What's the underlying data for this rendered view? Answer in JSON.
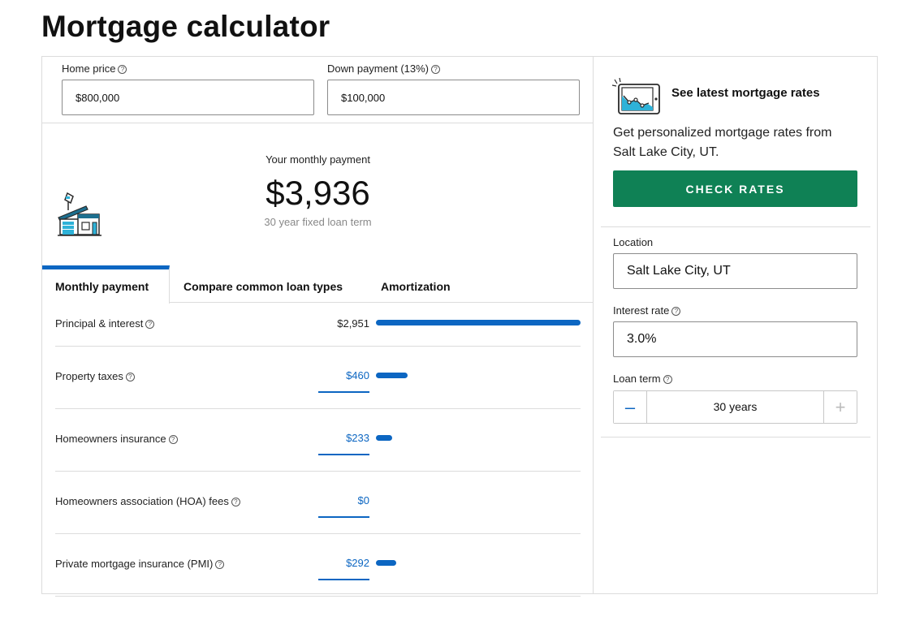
{
  "page_title": "Mortgage calculator",
  "help_glyph": "?",
  "home_price": {
    "label": "Home price",
    "value": "$800,000"
  },
  "down_payment": {
    "label": "Down payment (13%)",
    "value": "$100,000"
  },
  "monthly": {
    "label": "Your monthly payment",
    "amount": "$3,936",
    "term": "30 year fixed loan term",
    "icon": "house-icon"
  },
  "tabs": [
    {
      "label": "Monthly payment",
      "active": true
    },
    {
      "label": "Compare common loan types",
      "active": false
    },
    {
      "label": "Amortization",
      "active": false
    }
  ],
  "breakdown": [
    {
      "label": "Principal & interest",
      "value": "$2,951",
      "amount": 2951,
      "editable": false
    },
    {
      "label": "Property taxes",
      "value": "$460",
      "amount": 460,
      "editable": true
    },
    {
      "label": "Homeowners insurance",
      "value": "$233",
      "amount": 233,
      "editable": true
    },
    {
      "label": "Homeowners association (HOA) fees",
      "value": "$0",
      "amount": 0,
      "editable": true
    },
    {
      "label": "Private mortgage insurance (PMI)",
      "value": "$292",
      "amount": 292,
      "editable": true
    }
  ],
  "rates": {
    "title": "See latest mortgage rates",
    "description": "Get personalized mortgage rates from Salt Lake City, UT.",
    "button": "CHECK RATES",
    "icon": "rates-chart-icon"
  },
  "location": {
    "label": "Location",
    "value": "Salt Lake City, UT"
  },
  "interest_rate": {
    "label": "Interest rate",
    "value": "3.0%"
  },
  "loan_term": {
    "label": "Loan term",
    "value": "30 years",
    "minus": "–",
    "plus": "+"
  },
  "colors": {
    "accent": "#0c66c2",
    "button": "#0f8155",
    "border": "#dcdcdc"
  }
}
